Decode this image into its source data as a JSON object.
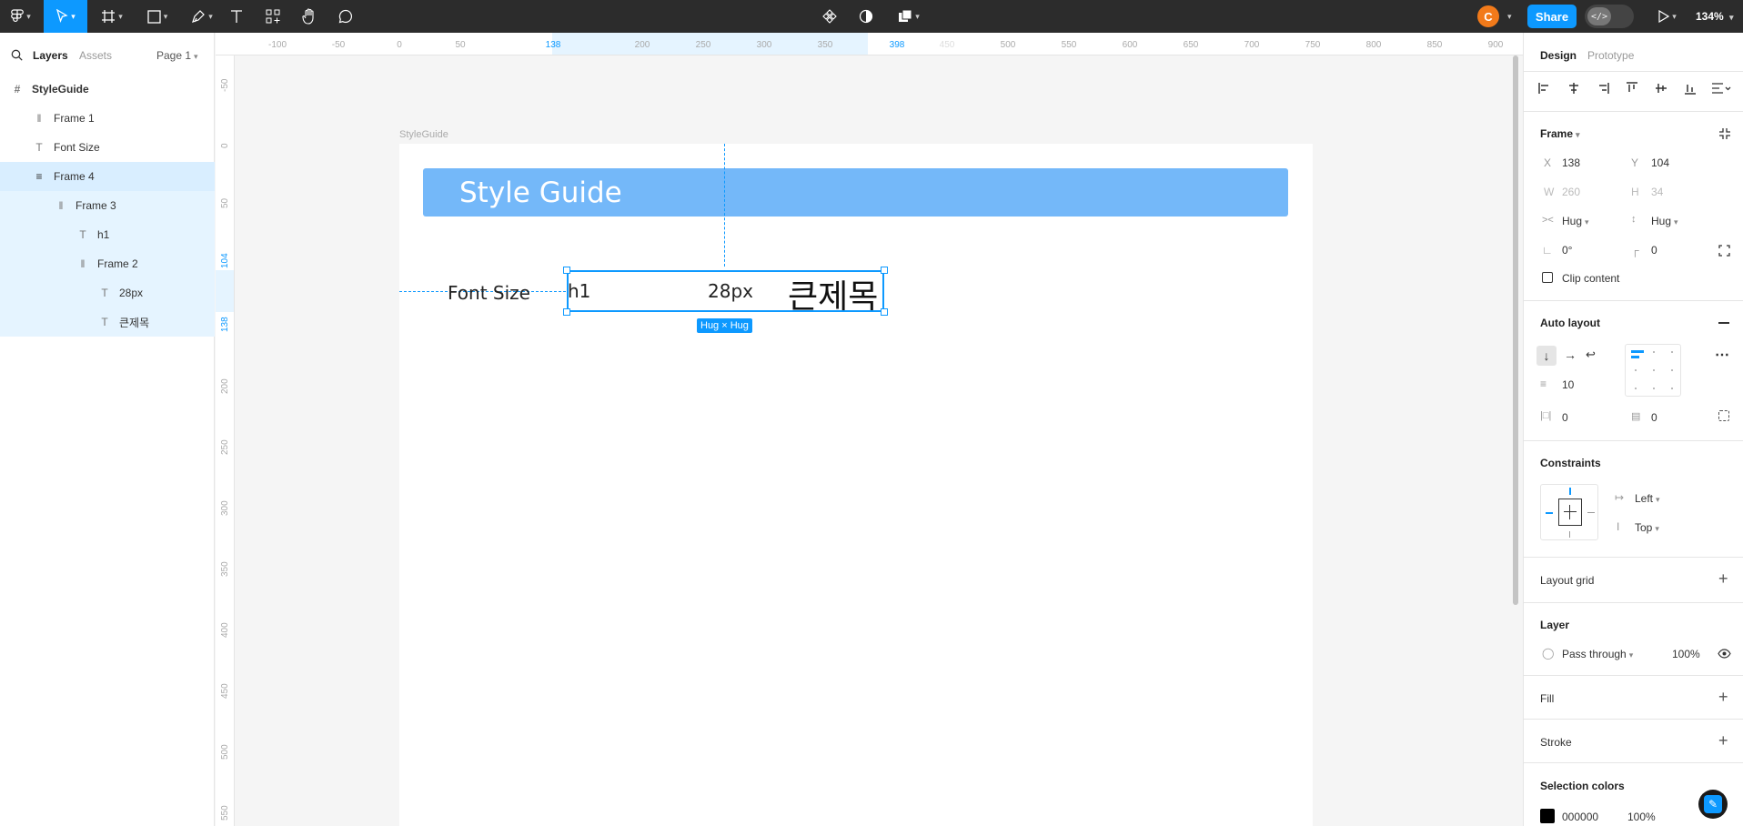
{
  "toolbar": {
    "share_label": "Share",
    "avatar_initial": "C",
    "zoom_label": "134%",
    "dev_mode_label": "</>"
  },
  "left_panel": {
    "tab_layers": "Layers",
    "tab_assets": "Assets",
    "page_label": "Page 1",
    "layers": [
      {
        "label": "StyleGuide",
        "icon": "frame-hash-icon"
      },
      {
        "label": "Frame 1",
        "icon": "autolayout-horizontal-icon"
      },
      {
        "label": "Font Size",
        "icon": "text-icon"
      },
      {
        "label": "Frame 4",
        "icon": "autolayout-vertical-icon"
      },
      {
        "label": "Frame 3",
        "icon": "autolayout-horizontal-icon"
      },
      {
        "label": "h1",
        "icon": "text-icon"
      },
      {
        "label": "Frame 2",
        "icon": "autolayout-horizontal-icon"
      },
      {
        "label": "28px",
        "icon": "text-icon"
      },
      {
        "label": "큰제목",
        "icon": "text-icon"
      }
    ]
  },
  "rulers": {
    "top_ticks": [
      "-100",
      "-50",
      "0",
      "50",
      "138",
      "200",
      "250",
      "300",
      "350",
      "398",
      "450",
      "500",
      "550",
      "600",
      "650",
      "700",
      "750",
      "800",
      "850",
      "900"
    ],
    "left_ticks": [
      "-50",
      "0",
      "50",
      "104",
      "138",
      "200",
      "250",
      "300",
      "350",
      "400",
      "450",
      "500",
      "550"
    ]
  },
  "canvas": {
    "frame_label": "StyleGuide",
    "banner_text": "Style Guide",
    "font_size_label": "Font Size",
    "text_h1": "h1",
    "text_28px": "28px",
    "text_korean": "큰제목",
    "selection_badge": "Hug × Hug"
  },
  "right_panel": {
    "tab_design": "Design",
    "tab_prototype": "Prototype",
    "frame_section": "Frame",
    "x_label": "X",
    "x_value": "138",
    "y_label": "Y",
    "y_value": "104",
    "w_label": "W",
    "w_value": "260",
    "h_label": "H",
    "h_value": "34",
    "width_mode": "Hug",
    "height_mode": "Hug",
    "rotation": "0°",
    "corner_radius": "0",
    "clip_content": "Clip content",
    "auto_layout_title": "Auto layout",
    "gap_value": "10",
    "padding_h": "0",
    "padding_v": "0",
    "constraints_title": "Constraints",
    "constraint_h": "Left",
    "constraint_v": "Top",
    "layout_grid_title": "Layout grid",
    "layer_title": "Layer",
    "blend_mode": "Pass through",
    "opacity": "100%",
    "fill_title": "Fill",
    "stroke_title": "Stroke",
    "selection_colors_title": "Selection colors",
    "color_hex": "000000",
    "color_opacity": "100%"
  },
  "colors": {
    "accent": "#0d99ff",
    "banner": "#74b8f9",
    "toolbar_bg": "#2c2c2c",
    "avatar": "#f27a1a"
  }
}
